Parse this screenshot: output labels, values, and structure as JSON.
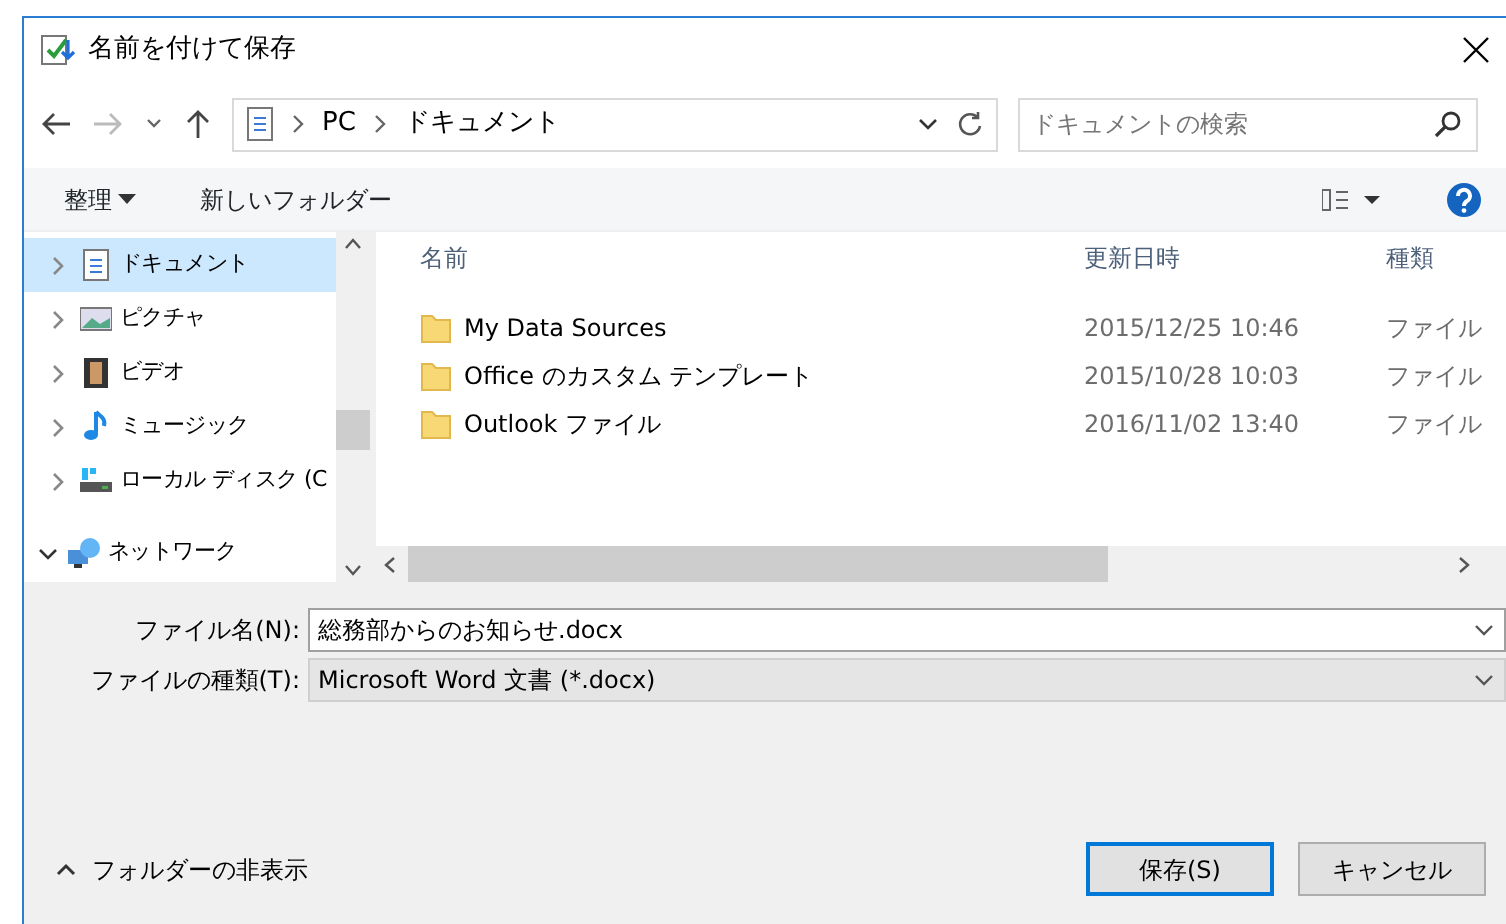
{
  "window": {
    "title": "名前を付けて保存"
  },
  "address_bar": {
    "path": [
      "PC",
      "ドキュメント"
    ]
  },
  "search": {
    "placeholder": "ドキュメントの検索"
  },
  "toolbar": {
    "organize": "整理",
    "new_folder": "新しいフォルダー"
  },
  "sidebar": {
    "items": [
      {
        "label": "ドキュメント",
        "kind": "documents",
        "selected": true,
        "expanded": false
      },
      {
        "label": "ピクチャ",
        "kind": "pictures",
        "selected": false,
        "expanded": false
      },
      {
        "label": "ビデオ",
        "kind": "videos",
        "selected": false,
        "expanded": false
      },
      {
        "label": "ミュージック",
        "kind": "music",
        "selected": false,
        "expanded": false
      },
      {
        "label": "ローカル ディスク (C",
        "kind": "disk",
        "selected": false,
        "expanded": false
      },
      {
        "label": "ネットワーク",
        "kind": "network",
        "selected": false,
        "expanded": true
      }
    ]
  },
  "file_list": {
    "columns": [
      "名前",
      "更新日時",
      "種類"
    ],
    "rows": [
      {
        "name": "My Data Sources",
        "modified": "2015/12/25 10:46",
        "type": "ファイル"
      },
      {
        "name": "Office のカスタム テンプレート",
        "modified": "2015/10/28 10:03",
        "type": "ファイル"
      },
      {
        "name": "Outlook ファイル",
        "modified": "2016/11/02 13:40",
        "type": "ファイル"
      }
    ]
  },
  "file_name": {
    "label": "ファイル名(N):",
    "value": "総務部からのお知らせ.docx"
  },
  "file_type": {
    "label": "ファイルの種類(T):",
    "value": "Microsoft Word 文書 (*.docx)"
  },
  "hide_folders": "フォルダーの非表示",
  "buttons": [
    {
      "label": "保存(S)",
      "default": true
    },
    {
      "label": "キャンセル",
      "default": false
    }
  ]
}
